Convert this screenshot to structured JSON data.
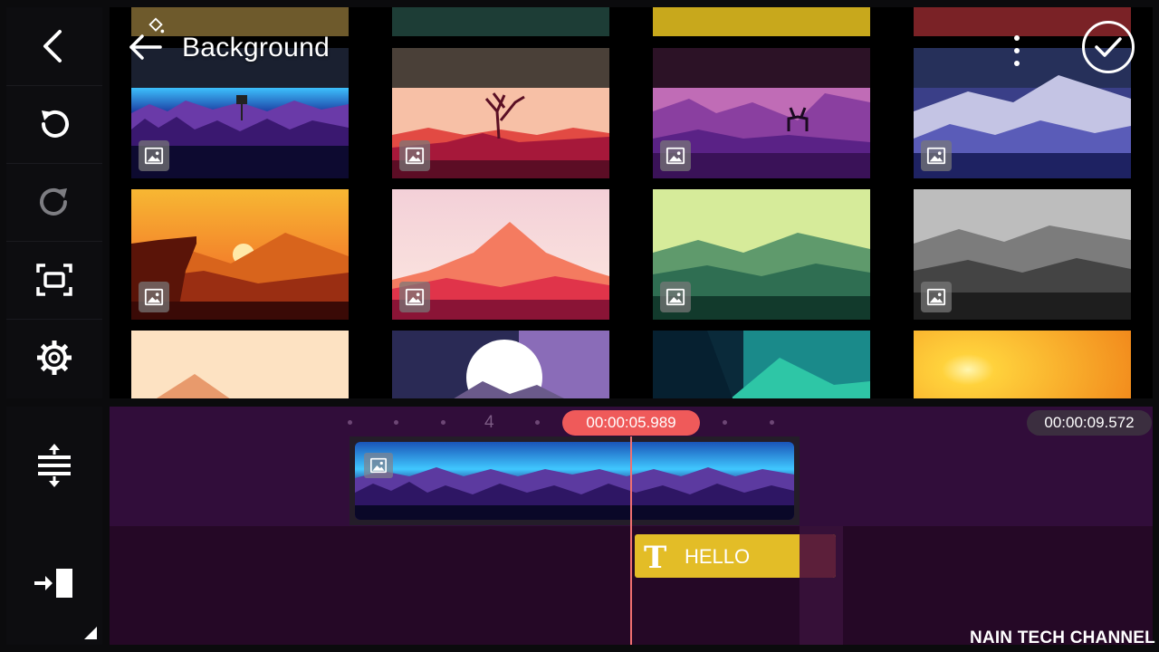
{
  "header": {
    "title": "Background"
  },
  "sidebar": {
    "buttons": [
      {
        "icon": "back-chevron-icon"
      },
      {
        "icon": "undo-icon"
      },
      {
        "icon": "redo-icon"
      },
      {
        "icon": "fullscreen-icon"
      },
      {
        "icon": "settings-gear-icon"
      }
    ],
    "timeline_buttons": [
      {
        "icon": "track-height-icon"
      },
      {
        "icon": "jump-to-end-icon"
      }
    ]
  },
  "grid": {
    "badge_icon": "image-icon",
    "top_row_colors": [
      "#6e5a2c",
      "#1d3d36",
      "#c8a81c",
      "#7a2226"
    ]
  },
  "timeline": {
    "ruler_number": "4",
    "current_time": "00:00:05.989",
    "total_time": "00:00:09.572",
    "text_clip_label": "HELLO",
    "text_clip_icon": "T"
  },
  "colors": {
    "accent": "#ef5a5a",
    "text_clip": "#e3bd27",
    "timeline_bg": "#310d3a"
  },
  "watermark": "NAIN TECH CHANNEL"
}
